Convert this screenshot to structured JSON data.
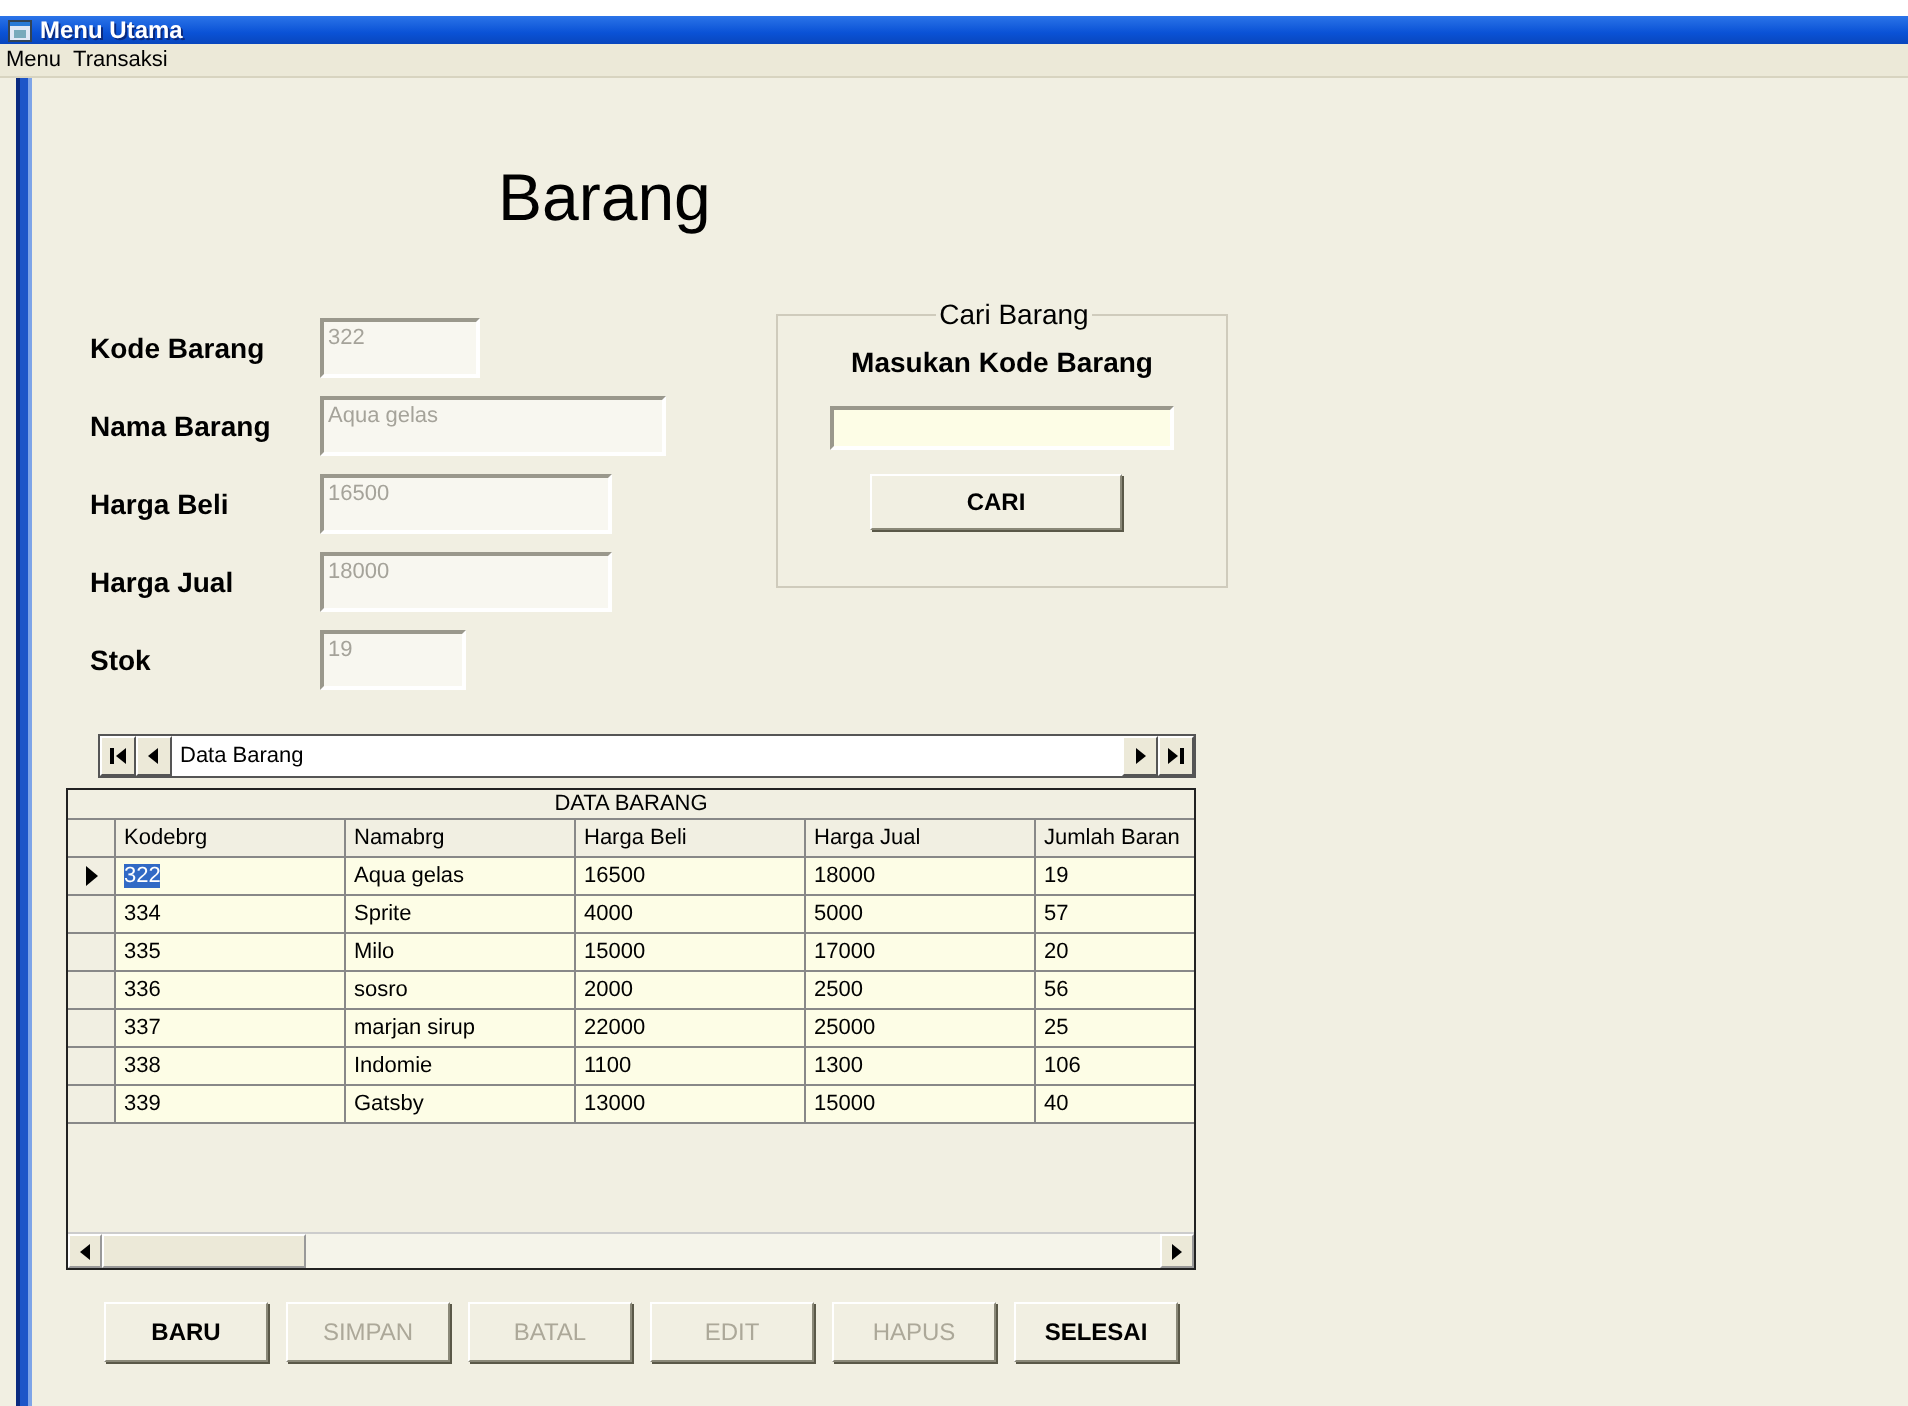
{
  "window": {
    "title": "Menu Utama"
  },
  "menu": [
    "Menu",
    "Transaksi"
  ],
  "heading": "Barang",
  "fields": [
    {
      "label": "Kode Barang",
      "value": "322",
      "disabled": true
    },
    {
      "label": "Nama Barang",
      "value": "Aqua gelas",
      "disabled": true
    },
    {
      "label": "Harga Beli",
      "value": "16500",
      "disabled": true
    },
    {
      "label": "Harga Jual",
      "value": "18000",
      "disabled": true
    },
    {
      "label": "Stok",
      "value": "19",
      "disabled": true
    }
  ],
  "search": {
    "title": "Cari Barang",
    "label": "Masukan Kode Barang",
    "button": "CARI"
  },
  "navigator": {
    "caption": "Data Barang"
  },
  "table": {
    "caption": "DATA BARANG",
    "columns": [
      "Kodebrg",
      "Namabrg",
      "Harga Beli",
      "Harga Jual",
      "Jumlah Baran"
    ],
    "rows": [
      {
        "selected": true,
        "cells": [
          "322",
          "Aqua gelas",
          "16500",
          "18000",
          "19"
        ]
      },
      {
        "selected": false,
        "cells": [
          "334",
          "Sprite",
          "4000",
          "5000",
          "57"
        ]
      },
      {
        "selected": false,
        "cells": [
          "335",
          "Milo",
          "15000",
          "17000",
          "20"
        ]
      },
      {
        "selected": false,
        "cells": [
          "336",
          "sosro",
          "2000",
          "2500",
          "56"
        ]
      },
      {
        "selected": false,
        "cells": [
          "337",
          "marjan sirup",
          "22000",
          "25000",
          "25"
        ]
      },
      {
        "selected": false,
        "cells": [
          "338",
          "Indomie",
          "1100",
          "1300",
          "106"
        ]
      },
      {
        "selected": false,
        "cells": [
          "339",
          "Gatsby",
          "13000",
          "15000",
          "40"
        ]
      }
    ]
  },
  "buttons": [
    {
      "label": "BARU",
      "disabled": false
    },
    {
      "label": "SIMPAN",
      "disabled": true
    },
    {
      "label": "BATAL",
      "disabled": true
    },
    {
      "label": "EDIT",
      "disabled": true
    },
    {
      "label": "HAPUS",
      "disabled": true
    },
    {
      "label": "SELESAI",
      "disabled": false
    }
  ]
}
